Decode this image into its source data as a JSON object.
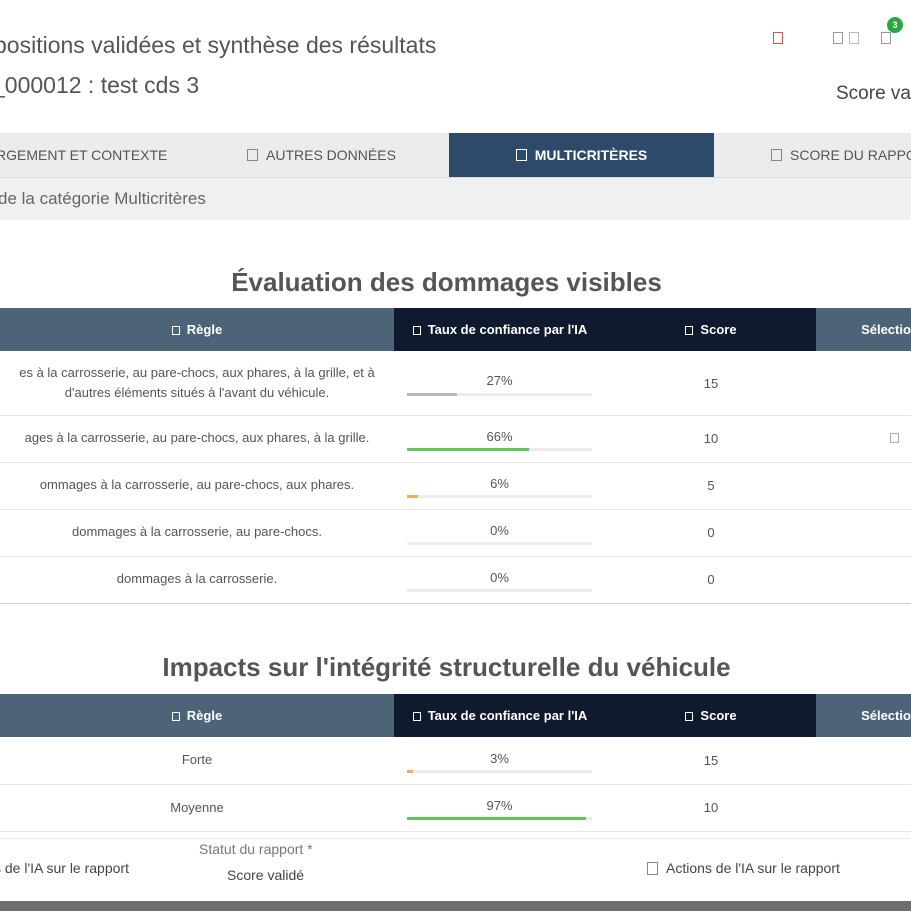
{
  "header": {
    "title": "positions validées et synthèse des résultats",
    "subtitle": "_000012 : test cds 3",
    "score_label": "Score va",
    "notification_count": "3",
    "icons": [
      "alert-icon",
      "grid-icon",
      "list-icon",
      "bell-icon"
    ]
  },
  "tabs": [
    {
      "label": "RGEMENT ET CONTEXTE",
      "active": false
    },
    {
      "label": "AUTRES DONNÉES",
      "active": false
    },
    {
      "label": "MULTICRITÈRES",
      "active": true
    },
    {
      "label": "SCORE DU RAPPOR",
      "active": false
    }
  ],
  "category_text": "de la catégorie Multicritères",
  "columns": {
    "rule": "Règle",
    "confidence": "Taux de confiance par l'IA",
    "score": "Score",
    "selection": "Sélectio"
  },
  "sections": [
    {
      "title": "Évaluation des dommages visibles",
      "rows": [
        {
          "rule_l1": "es à la carrosserie, au pare-chocs, aux phares, à la grille, et à",
          "rule_l2": "d'autres éléments situés à l'avant du véhicule.",
          "confidence": "27%",
          "confidence_value": 0.27,
          "bar_color": "#b8b8b8",
          "score": "15",
          "selected": false
        },
        {
          "rule_l1": "ages à la carrosserie, au pare-chocs, aux phares, à la grille.",
          "rule_l2": "",
          "confidence": "66%",
          "confidence_value": 0.66,
          "bar_color": "#5cc85c",
          "score": "10",
          "selected": true
        },
        {
          "rule_l1": "ommages à la carrosserie, au pare-chocs, aux phares.",
          "rule_l2": "",
          "confidence": "6%",
          "confidence_value": 0.06,
          "bar_color": "#f0ad4e",
          "score": "5",
          "selected": false
        },
        {
          "rule_l1": "dommages à la carrosserie, au pare-chocs.",
          "rule_l2": "",
          "confidence": "0%",
          "confidence_value": 0,
          "bar_color": "#cccccc",
          "score": "0",
          "selected": false
        },
        {
          "rule_l1": "dommages à la carrosserie.",
          "rule_l2": "",
          "confidence": "0%",
          "confidence_value": 0,
          "bar_color": "#cccccc",
          "score": "0",
          "selected": false
        }
      ]
    },
    {
      "title": "Impacts sur l'intégrité structurelle du véhicule",
      "rows": [
        {
          "rule_l1": "Forte",
          "rule_l2": "",
          "confidence": "3%",
          "confidence_value": 0.03,
          "bar_color": "#f0ad4e",
          "score": "15",
          "selected": false
        },
        {
          "rule_l1": "Moyenne",
          "rule_l2": "",
          "confidence": "97%",
          "confidence_value": 0.97,
          "bar_color": "#5cc85c",
          "score": "10",
          "selected": false
        }
      ]
    }
  ],
  "footer": {
    "left_label": "s de l'IA sur le rapport",
    "status_label": "Statut du rapport *",
    "status_value": "Score validé",
    "right_label": "Actions de l'IA sur le rapport"
  }
}
